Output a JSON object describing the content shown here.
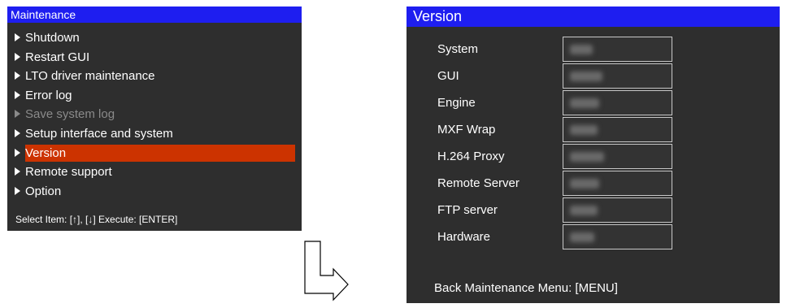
{
  "maintenance": {
    "title": "Maintenance",
    "items": [
      {
        "label": "Shutdown"
      },
      {
        "label": "Restart GUI"
      },
      {
        "label": "LTO driver maintenance"
      },
      {
        "label": "Error log"
      },
      {
        "label": "Save system log",
        "disabled": true
      },
      {
        "label": "Setup interface and system"
      },
      {
        "label": "Version",
        "selected": true
      },
      {
        "label": "Remote support"
      },
      {
        "label": "Option"
      }
    ],
    "footer": "Select Item:  [↑], [↓]   Execute: [ENTER]"
  },
  "version": {
    "title": "Version",
    "rows": [
      {
        "label": "System"
      },
      {
        "label": "GUI"
      },
      {
        "label": "Engine"
      },
      {
        "label": "MXF Wrap"
      },
      {
        "label": "H.264 Proxy"
      },
      {
        "label": "Remote Server"
      },
      {
        "label": "FTP server"
      },
      {
        "label": "Hardware"
      }
    ],
    "footer": "Back Maintenance Menu: [MENU]"
  },
  "colors": {
    "titlebar": "#1e1ef0",
    "panel_bg": "#2e2e2e",
    "selected": "#cc3300"
  },
  "icons": {
    "menu_bullet": "triangle-right-icon",
    "transition": "arrow-down-right-icon"
  }
}
